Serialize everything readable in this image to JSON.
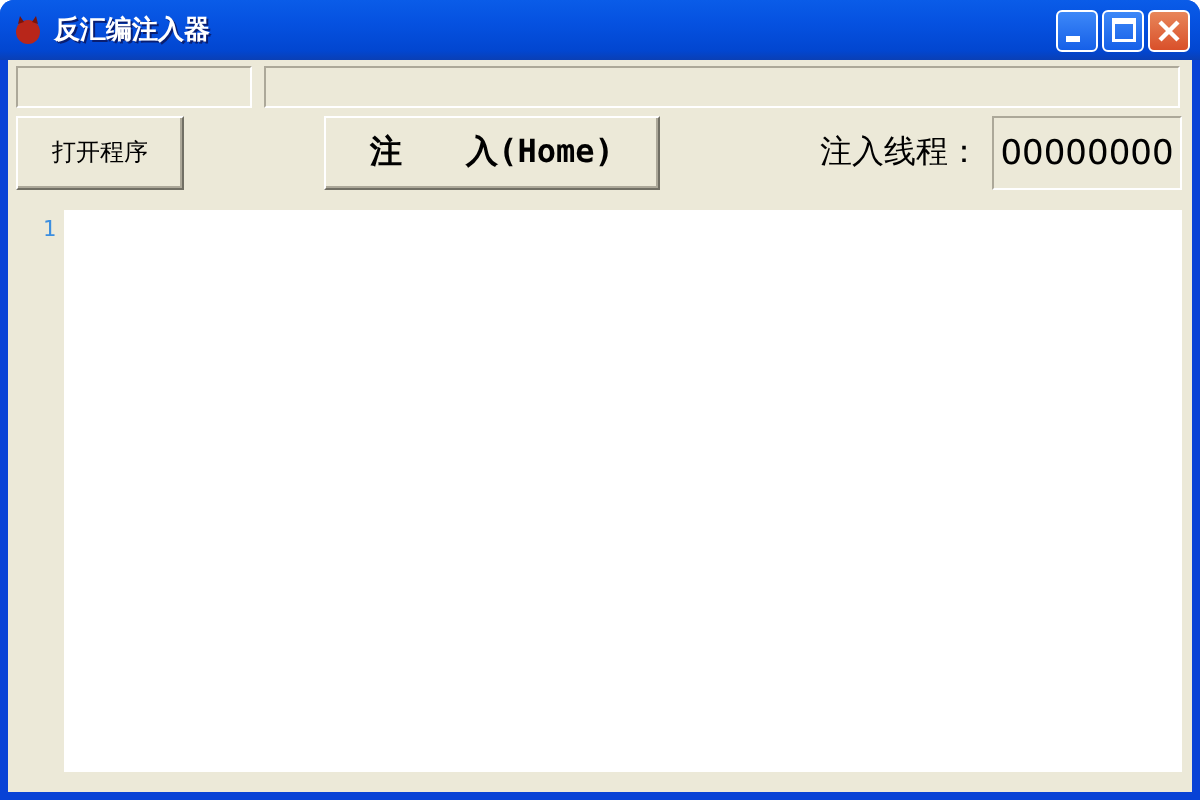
{
  "window": {
    "title": "反汇编注入器"
  },
  "toolbar": {
    "open_button": "打开程序",
    "inject_button": "注　　入(Home)",
    "thread_label": "注入线程：",
    "thread_value": "00000000"
  },
  "editor": {
    "line_numbers": [
      "1"
    ]
  }
}
